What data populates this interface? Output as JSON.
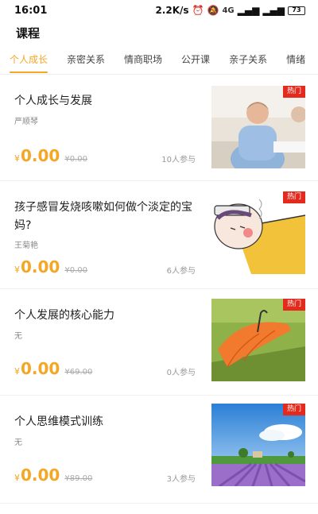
{
  "status": {
    "time": "16:01",
    "speed": "2.2K/s",
    "signal": "4G",
    "battery": "73"
  },
  "header": {
    "title": "课程"
  },
  "tabs": [
    "个人成长",
    "亲密关系",
    "情商职场",
    "公开课",
    "亲子关系",
    "情绪"
  ],
  "active_tab": "个人成长",
  "courses": [
    {
      "title": "个人成长与发展",
      "author": "严顺琴",
      "currency": "¥",
      "price": "0.00",
      "original_price": "¥0.00",
      "participants": "10人参与",
      "badge": "热门",
      "image": "man-consulting-photo"
    },
    {
      "title": "孩子感冒发烧咳嗽如何做个淡定的宝妈?",
      "author": "王菊艳",
      "currency": "¥",
      "price": "0.00",
      "original_price": "¥0.00",
      "participants": "6人参与",
      "badge": "热门",
      "image": "sick-child-cartoon"
    },
    {
      "title": "个人发展的核心能力",
      "author": "无",
      "currency": "¥",
      "price": "0.00",
      "original_price": "¥69.00",
      "participants": "0人参与",
      "badge": "热门",
      "image": "orange-umbrella-photo"
    },
    {
      "title": "个人思维模式训练",
      "author": "无",
      "currency": "¥",
      "price": "0.00",
      "original_price": "¥89.00",
      "participants": "3人参与",
      "badge": "热门",
      "image": "lavender-field-photo"
    }
  ]
}
